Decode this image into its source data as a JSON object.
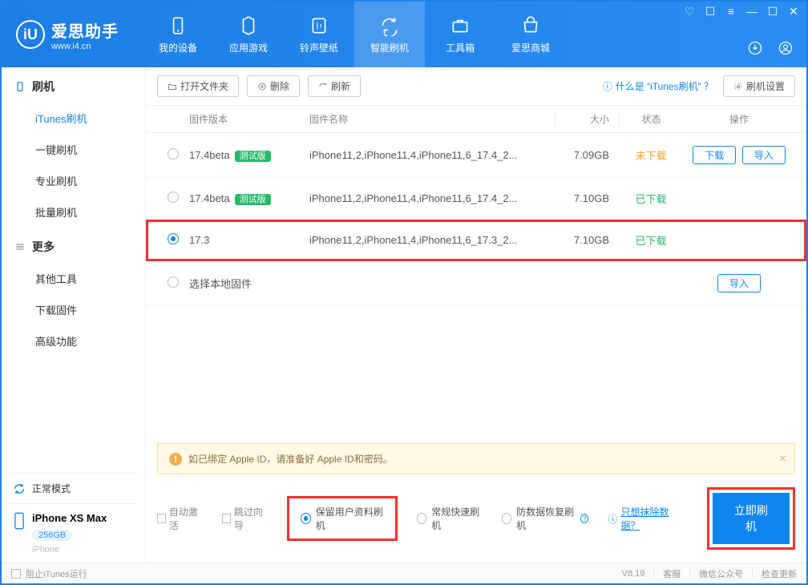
{
  "app": {
    "title": "爱思助手",
    "site": "www.i4.cn"
  },
  "nav": {
    "my_device": "我的设备",
    "apps": "应用游戏",
    "ringtones": "铃声壁纸",
    "flash": "智能刷机",
    "tools": "工具箱",
    "store": "爱思商城"
  },
  "sidebar": {
    "group_flash": "刷机",
    "itunes_flash": "iTunes刷机",
    "one_click": "一键刷机",
    "pro_flash": "专业刷机",
    "batch_flash": "批量刷机",
    "group_more": "更多",
    "other_tools": "其他工具",
    "download_fw": "下载固件",
    "advanced": "高级功能",
    "normal_mode": "正常模式",
    "device_name": "iPhone XS Max",
    "capacity": "256GB",
    "device_type": "iPhone"
  },
  "toolbar": {
    "open_folder": "打开文件夹",
    "delete": "删除",
    "refresh": "刷新",
    "help": "什么是 “iTunes刷机” ？",
    "settings": "刷机设置"
  },
  "table": {
    "h_version": "固件版本",
    "h_name": "固件名称",
    "h_size": "大小",
    "h_status": "状态",
    "h_action": "操作",
    "rows": [
      {
        "ver": "17.4beta",
        "beta": "测试版",
        "name": "iPhone11,2,iPhone11,4,iPhone11,6_17.4_2...",
        "size": "7.09GB",
        "status": "未下载",
        "status_cls": "st-not",
        "download": "下载",
        "import": "导入",
        "sel": false
      },
      {
        "ver": "17.4beta",
        "beta": "测试版",
        "name": "iPhone11,2,iPhone11,4,iPhone11,6_17.4_2...",
        "size": "7.10GB",
        "status": "已下载",
        "status_cls": "st-done",
        "sel": false
      },
      {
        "ver": "17.3",
        "name": "iPhone11,2,iPhone11,4,iPhone11,6_17.3_2...",
        "size": "7.10GB",
        "status": "已下载",
        "status_cls": "st-done",
        "sel": true
      }
    ],
    "local_row": "选择本地固件",
    "import": "导入"
  },
  "warning": "如已绑定 Apple ID，请准备好 Apple ID和密码。",
  "bottom": {
    "auto_activate": "自动激活",
    "skip_guide": "跳过向导",
    "opt1": "保留用户资料刷机",
    "opt2": "常规快速刷机",
    "opt3": "防数据恢复刷机",
    "erase_link": "只想抹除数据？",
    "primary": "立即刷机"
  },
  "footer": {
    "block_itunes": "阻止iTunes运行",
    "version": "V8.19",
    "service": "客服",
    "wechat": "微信公众号",
    "update": "检查更新"
  }
}
